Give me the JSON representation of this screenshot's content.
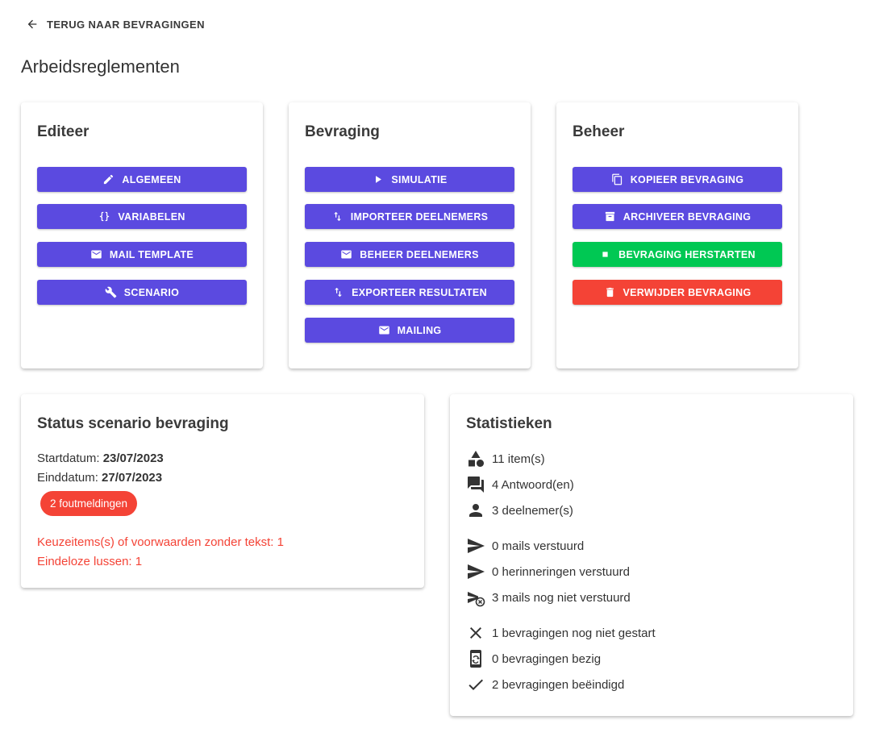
{
  "nav": {
    "back_label": "TERUG NAAR BEVRAGINGEN"
  },
  "page": {
    "title": "Arbeidsreglementen"
  },
  "edit_card": {
    "title": "Editeer",
    "buttons": [
      {
        "label": "ALGEMEEN",
        "icon": "pencil-icon"
      },
      {
        "label": "VARIABELEN",
        "icon": "braces-icon"
      },
      {
        "label": "MAIL TEMPLATE",
        "icon": "mail-icon"
      },
      {
        "label": "SCENARIO",
        "icon": "wrench-icon"
      }
    ]
  },
  "survey_card": {
    "title": "Bevraging",
    "buttons": [
      {
        "label": "SIMULATIE",
        "icon": "play-icon"
      },
      {
        "label": "IMPORTEER DEELNEMERS",
        "icon": "swap-vertical-icon"
      },
      {
        "label": "BEHEER DEELNEMERS",
        "icon": "mail-icon"
      },
      {
        "label": "EXPORTEER RESULTATEN",
        "icon": "swap-vertical-icon"
      },
      {
        "label": "MAILING",
        "icon": "mail-icon"
      }
    ]
  },
  "manage_card": {
    "title": "Beheer",
    "buttons": [
      {
        "label": "KOPIEER BEVRAGING",
        "icon": "copy-icon",
        "color": "#5b4ae0"
      },
      {
        "label": "ARCHIVEER BEVRAGING",
        "icon": "archive-icon",
        "color": "#5b4ae0"
      },
      {
        "label": "BEVRAGING HERSTARTEN",
        "icon": "stop-icon",
        "color": "#00c853"
      },
      {
        "label": "VERWIJDER BEVRAGING",
        "icon": "trash-icon",
        "color": "#f44336"
      }
    ]
  },
  "status_card": {
    "title": "Status scenario bevraging",
    "start_label": "Startdatum: ",
    "start_value": "23/07/2023",
    "end_label": "Einddatum: ",
    "end_value": "27/07/2023",
    "error_badge": "2 foutmeldingen",
    "errors": [
      "Keuzeitems(s) of voorwaarden zonder tekst: 1",
      "Eindeloze lussen: 1"
    ],
    "error_color": "#f44336"
  },
  "stats_card": {
    "title": "Statistieken",
    "items": [
      {
        "text": "11 item(s)",
        "icon": "shapes-icon"
      },
      {
        "text": "4 Antwoord(en)",
        "icon": "forum-icon"
      },
      {
        "text": "3 deelnemer(s)",
        "icon": "person-icon"
      },
      {
        "text": "0 mails verstuurd",
        "icon": "send-icon"
      },
      {
        "text": "0 herinneringen verstuurd",
        "icon": "send-icon"
      },
      {
        "text": "3 mails nog niet verstuurd",
        "icon": "send-clock-icon"
      },
      {
        "text": "1 bevragingen nog niet gestart",
        "icon": "close-icon"
      },
      {
        "text": "0 bevragingen bezig",
        "icon": "phone-sync-icon"
      },
      {
        "text": "2 bevragingen beëindigd",
        "icon": "check-icon"
      }
    ]
  },
  "colors": {
    "primary": "#5b4ae0",
    "success": "#00c853",
    "danger": "#f44336"
  }
}
